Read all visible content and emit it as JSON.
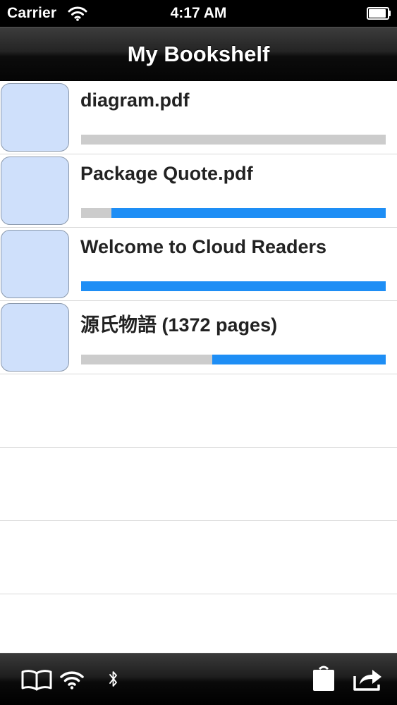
{
  "status_bar": {
    "carrier": "Carrier",
    "time": "4:17 AM"
  },
  "nav": {
    "title": "My Bookshelf"
  },
  "books": [
    {
      "title": "diagram.pdf",
      "progress": 0.0
    },
    {
      "title": "Package Quote.pdf",
      "progress": 0.9
    },
    {
      "title": "Welcome to Cloud Readers",
      "progress": 1.0
    },
    {
      "title": "源氏物語 (1372 pages)",
      "progress": 0.57
    }
  ],
  "toolbar": {
    "icons": [
      "book-icon",
      "wifi-icon",
      "bluetooth-icon",
      "shopping-bag-icon",
      "share-icon"
    ]
  },
  "colors": {
    "progress_fill": "#1e8ef5",
    "progress_track": "#cccccc",
    "thumb_bg": "#cfe0fb"
  }
}
